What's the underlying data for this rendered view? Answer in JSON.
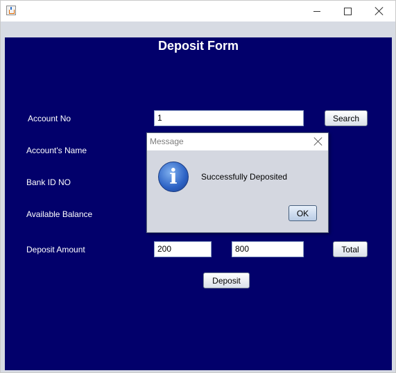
{
  "window": {
    "title": ""
  },
  "form": {
    "title": "Deposit Form",
    "labels": {
      "account_no": "Account No",
      "accounts_name": "Account's Name",
      "bank_id": "Bank ID NO",
      "available_balance": "Available Balance",
      "deposit_amount": "Deposit Amount"
    },
    "fields": {
      "account_no": "1",
      "deposit_amount": "200",
      "total": "800"
    },
    "buttons": {
      "search": "Search",
      "total": "Total",
      "deposit": "Deposit"
    }
  },
  "dialog": {
    "title": "Message",
    "message": "Successfully Deposited",
    "ok": "OK",
    "icon": "info-icon"
  },
  "colors": {
    "panel": "#02006b",
    "window_bg": "#d7dbe3"
  }
}
